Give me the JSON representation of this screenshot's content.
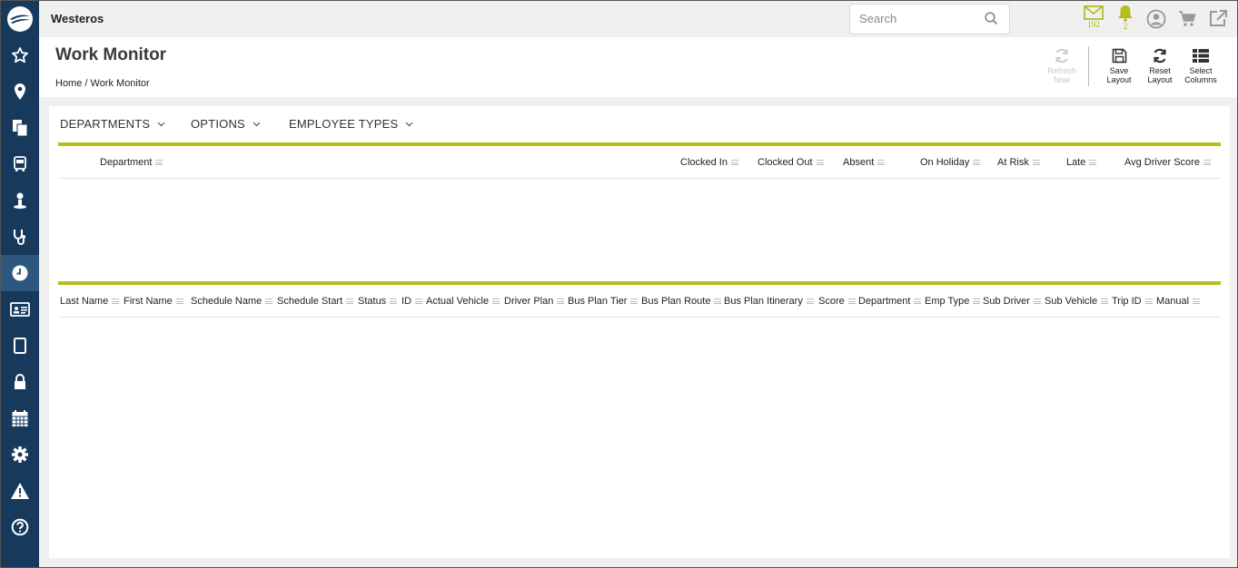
{
  "app": {
    "brand": "Westeros",
    "colors": {
      "sidebar": "#16395c",
      "sidebar_active": "#2e577f",
      "accent": "#b5bd1c",
      "badge": "#a8b81a"
    }
  },
  "sidebar": {
    "items": [
      {
        "icon": "logo-icon"
      },
      {
        "icon": "star-icon"
      },
      {
        "icon": "map-pin-icon"
      },
      {
        "icon": "documents-icon"
      },
      {
        "icon": "bus-icon"
      },
      {
        "icon": "user-icon"
      },
      {
        "icon": "stethoscope-icon"
      },
      {
        "icon": "clock-icon",
        "active": true
      },
      {
        "icon": "id-card-icon"
      },
      {
        "icon": "tablet-icon"
      },
      {
        "icon": "lock-icon"
      },
      {
        "icon": "calendar-icon"
      },
      {
        "icon": "gear-icon"
      },
      {
        "icon": "warning-icon"
      },
      {
        "icon": "help-icon"
      }
    ]
  },
  "search": {
    "placeholder": "Search"
  },
  "topbar": {
    "mail_count": "192",
    "alert_count": "2"
  },
  "header": {
    "title": "Work Monitor",
    "breadcrumb": "Home / Work Monitor"
  },
  "toolbar": {
    "refresh": [
      "Refresh",
      "Now"
    ],
    "save": [
      "Save",
      "Layout"
    ],
    "reset": [
      "Reset",
      "Layout"
    ],
    "select": [
      "Select",
      "Columns"
    ]
  },
  "filters": [
    "DEPARTMENTS",
    "OPTIONS",
    "EMPLOYEE TYPES"
  ],
  "summary_table": {
    "columns": [
      "Department",
      "Clocked In",
      "Clocked Out",
      "Absent",
      "On Holiday",
      "At Risk",
      "Late",
      "Avg Driver Score"
    ]
  },
  "detail_table": {
    "columns": [
      "Last Name",
      "First Name",
      "Schedule Name",
      "Schedule Start",
      "Status",
      "ID",
      "Actual Vehicle",
      "Driver Plan",
      "Bus Plan Tier",
      "Bus Plan Route",
      "Bus Plan Itinerary",
      "Score",
      "Department",
      "Emp Type",
      "Sub Driver",
      "Sub Vehicle",
      "Trip ID",
      "Manual"
    ]
  }
}
